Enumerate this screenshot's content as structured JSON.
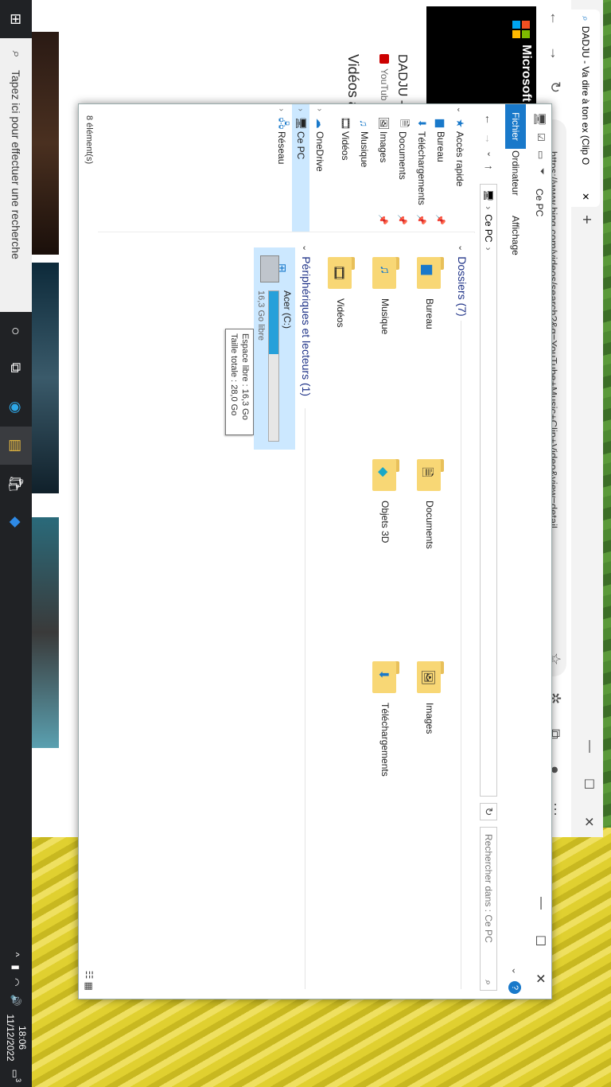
{
  "taskbar": {
    "search_placeholder": "Tapez ici pour effectuer une recherche",
    "time": "18:06",
    "date": "11/12/2022",
    "notification_count": "3"
  },
  "browser": {
    "tab_title": "DADJU - Va dire à ton ex (Clip O",
    "url": "https://www.bing.com/videos/search?&q=YouTube+Music+Clip+Video&view=detail",
    "brand": "Microsoft B",
    "video_title": "DADJU -",
    "video_source": "YouTub",
    "videos_heading": "Vidéos a"
  },
  "explorer": {
    "title": "Ce PC",
    "ribbon_tabs": [
      "Fichier",
      "Ordinateur",
      "Affichage"
    ],
    "breadcrumb": "Ce PC",
    "search_placeholder": "Rechercher dans : Ce PC",
    "nav": {
      "quick_access": "Accès rapide",
      "items": [
        "Bureau",
        "Téléchargements",
        "Documents",
        "Images",
        "Musique",
        "Vidéos"
      ],
      "onedrive": "OneDrive",
      "this_pc": "Ce PC",
      "network": "Réseau"
    },
    "folders_heading": "Dossiers (7)",
    "folders": [
      "Bureau",
      "Documents",
      "Images",
      "Musique",
      "Objets 3D",
      "Téléchargements",
      "Vidéos"
    ],
    "devices_heading": "Périphériques et lecteurs (1)",
    "drive": {
      "name": "Acer (C:)",
      "free_text": "16,3 Go libre",
      "used_fraction": 0.42
    },
    "tooltip": {
      "line1": "Espace libre : 16,3 Go",
      "line2": "Taille totale : 28,0 Go"
    },
    "status": "8 élément(s)"
  },
  "colors": {
    "accent": "#1979ca",
    "selection": "#cce8ff",
    "folder": "#f8d775",
    "taskbar": "#202225"
  }
}
